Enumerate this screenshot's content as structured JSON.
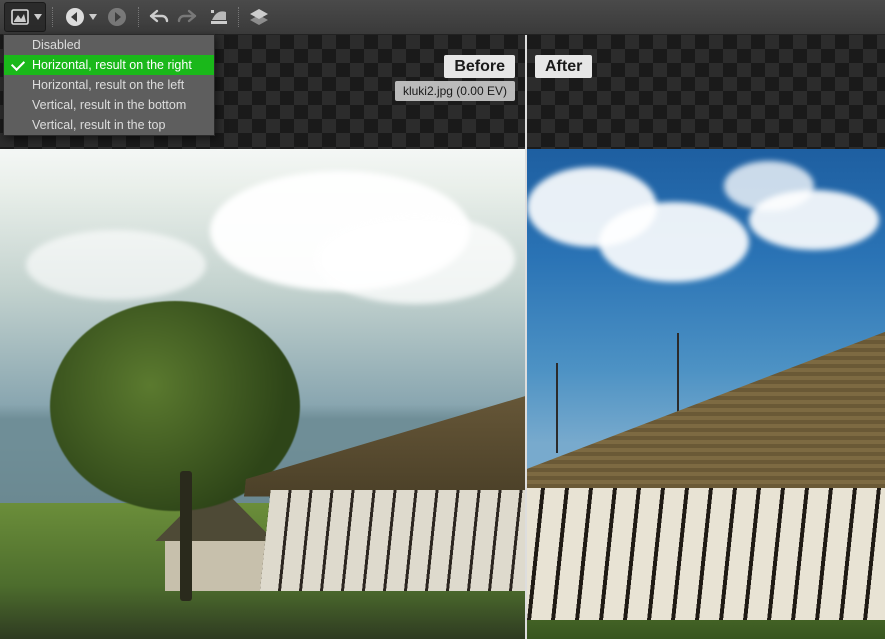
{
  "toolbar": {
    "compare_mode_icon": "image-compare-icon",
    "nav_back_icon": "arrow-left-circle-icon",
    "nav_fwd_icon": "arrow-right-circle-icon",
    "undo_icon": "undo-icon",
    "redo_icon": "redo-icon",
    "levels_icon": "curves-icon",
    "layers_icon": "layers-icon"
  },
  "dropdown": {
    "options": [
      {
        "label": "Disabled",
        "selected": false
      },
      {
        "label": "Horizontal, result on the right",
        "selected": true
      },
      {
        "label": "Horizontal, result on the left",
        "selected": false
      },
      {
        "label": "Vertical, result in the bottom",
        "selected": false
      },
      {
        "label": "Vertical, result in the top",
        "selected": false
      }
    ]
  },
  "preview": {
    "before_label": "Before",
    "after_label": "After",
    "filename_ev": "kluki2.jpg (0.00 EV)"
  }
}
